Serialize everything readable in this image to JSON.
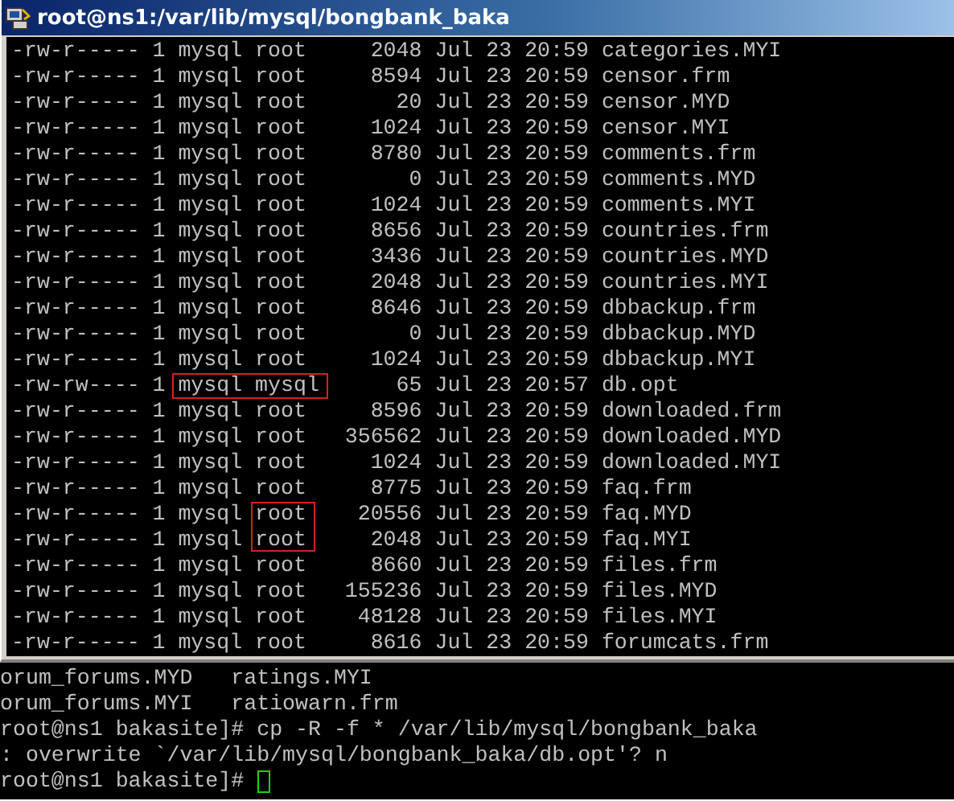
{
  "window": {
    "title": "root@ns1:/var/lib/mysql/bongbank_baka"
  },
  "rows": [
    {
      "perms": "-rw-r-----",
      "links": "1",
      "owner": "mysql",
      "group": "root",
      "size": "2048",
      "date": "Jul 23 20:59",
      "name": "categories.MYI",
      "owner_boxed": false,
      "group_boxed": false
    },
    {
      "perms": "-rw-r-----",
      "links": "1",
      "owner": "mysql",
      "group": "root",
      "size": "8594",
      "date": "Jul 23 20:59",
      "name": "censor.frm",
      "owner_boxed": false,
      "group_boxed": false
    },
    {
      "perms": "-rw-r-----",
      "links": "1",
      "owner": "mysql",
      "group": "root",
      "size": "20",
      "date": "Jul 23 20:59",
      "name": "censor.MYD",
      "owner_boxed": false,
      "group_boxed": false
    },
    {
      "perms": "-rw-r-----",
      "links": "1",
      "owner": "mysql",
      "group": "root",
      "size": "1024",
      "date": "Jul 23 20:59",
      "name": "censor.MYI",
      "owner_boxed": false,
      "group_boxed": false
    },
    {
      "perms": "-rw-r-----",
      "links": "1",
      "owner": "mysql",
      "group": "root",
      "size": "8780",
      "date": "Jul 23 20:59",
      "name": "comments.frm",
      "owner_boxed": false,
      "group_boxed": false
    },
    {
      "perms": "-rw-r-----",
      "links": "1",
      "owner": "mysql",
      "group": "root",
      "size": "0",
      "date": "Jul 23 20:59",
      "name": "comments.MYD",
      "owner_boxed": false,
      "group_boxed": false
    },
    {
      "perms": "-rw-r-----",
      "links": "1",
      "owner": "mysql",
      "group": "root",
      "size": "1024",
      "date": "Jul 23 20:59",
      "name": "comments.MYI",
      "owner_boxed": false,
      "group_boxed": false
    },
    {
      "perms": "-rw-r-----",
      "links": "1",
      "owner": "mysql",
      "group": "root",
      "size": "8656",
      "date": "Jul 23 20:59",
      "name": "countries.frm",
      "owner_boxed": false,
      "group_boxed": false
    },
    {
      "perms": "-rw-r-----",
      "links": "1",
      "owner": "mysql",
      "group": "root",
      "size": "3436",
      "date": "Jul 23 20:59",
      "name": "countries.MYD",
      "owner_boxed": false,
      "group_boxed": false
    },
    {
      "perms": "-rw-r-----",
      "links": "1",
      "owner": "mysql",
      "group": "root",
      "size": "2048",
      "date": "Jul 23 20:59",
      "name": "countries.MYI",
      "owner_boxed": false,
      "group_boxed": false
    },
    {
      "perms": "-rw-r-----",
      "links": "1",
      "owner": "mysql",
      "group": "root",
      "size": "8646",
      "date": "Jul 23 20:59",
      "name": "dbbackup.frm",
      "owner_boxed": false,
      "group_boxed": false
    },
    {
      "perms": "-rw-r-----",
      "links": "1",
      "owner": "mysql",
      "group": "root",
      "size": "0",
      "date": "Jul 23 20:59",
      "name": "dbbackup.MYD",
      "owner_boxed": false,
      "group_boxed": false
    },
    {
      "perms": "-rw-r-----",
      "links": "1",
      "owner": "mysql",
      "group": "root",
      "size": "1024",
      "date": "Jul 23 20:59",
      "name": "dbbackup.MYI",
      "owner_boxed": false,
      "group_boxed": false
    },
    {
      "perms": "-rw-rw----",
      "links": "1",
      "owner": "mysql",
      "group": "mysql",
      "size": "65",
      "date": "Jul 23 20:57",
      "name": "db.opt",
      "owner_boxed": true,
      "group_boxed": true
    },
    {
      "perms": "-rw-r-----",
      "links": "1",
      "owner": "mysql",
      "group": "root",
      "size": "8596",
      "date": "Jul 23 20:59",
      "name": "downloaded.frm",
      "owner_boxed": false,
      "group_boxed": false
    },
    {
      "perms": "-rw-r-----",
      "links": "1",
      "owner": "mysql",
      "group": "root",
      "size": "356562",
      "date": "Jul 23 20:59",
      "name": "downloaded.MYD",
      "owner_boxed": false,
      "group_boxed": false
    },
    {
      "perms": "-rw-r-----",
      "links": "1",
      "owner": "mysql",
      "group": "root",
      "size": "1024",
      "date": "Jul 23 20:59",
      "name": "downloaded.MYI",
      "owner_boxed": false,
      "group_boxed": false
    },
    {
      "perms": "-rw-r-----",
      "links": "1",
      "owner": "mysql",
      "group": "root",
      "size": "8775",
      "date": "Jul 23 20:59",
      "name": "faq.frm",
      "owner_boxed": false,
      "group_boxed": false
    },
    {
      "perms": "-rw-r-----",
      "links": "1",
      "owner": "mysql",
      "group": "root",
      "size": "20556",
      "date": "Jul 23 20:59",
      "name": "faq.MYD",
      "owner_boxed": false,
      "group_boxed": true
    },
    {
      "perms": "-rw-r-----",
      "links": "1",
      "owner": "mysql",
      "group": "root",
      "size": "2048",
      "date": "Jul 23 20:59",
      "name": "faq.MYI",
      "owner_boxed": false,
      "group_boxed": true
    },
    {
      "perms": "-rw-r-----",
      "links": "1",
      "owner": "mysql",
      "group": "root",
      "size": "8660",
      "date": "Jul 23 20:59",
      "name": "files.frm",
      "owner_boxed": false,
      "group_boxed": false
    },
    {
      "perms": "-rw-r-----",
      "links": "1",
      "owner": "mysql",
      "group": "root",
      "size": "155236",
      "date": "Jul 23 20:59",
      "name": "files.MYD",
      "owner_boxed": false,
      "group_boxed": false
    },
    {
      "perms": "-rw-r-----",
      "links": "1",
      "owner": "mysql",
      "group": "root",
      "size": "48128",
      "date": "Jul 23 20:59",
      "name": "files.MYI",
      "owner_boxed": false,
      "group_boxed": false
    },
    {
      "perms": "-rw-r-----",
      "links": "1",
      "owner": "mysql",
      "group": "root",
      "size": "8616",
      "date": "Jul 23 20:59",
      "name": "forumcats.frm",
      "owner_boxed": false,
      "group_boxed": false
    }
  ],
  "back_terminal": {
    "lines": [
      "orum_forums.MYD   ratings.MYI",
      "orum_forums.MYI   ratiowarn.frm",
      "root@ns1 bakasite]# cp -R -f * /var/lib/mysql/bongbank_baka",
      ": overwrite `/var/lib/mysql/bongbank_baka/db.opt'? n"
    ],
    "prompt": "root@ns1 bakasite]#",
    "cursor": true
  }
}
